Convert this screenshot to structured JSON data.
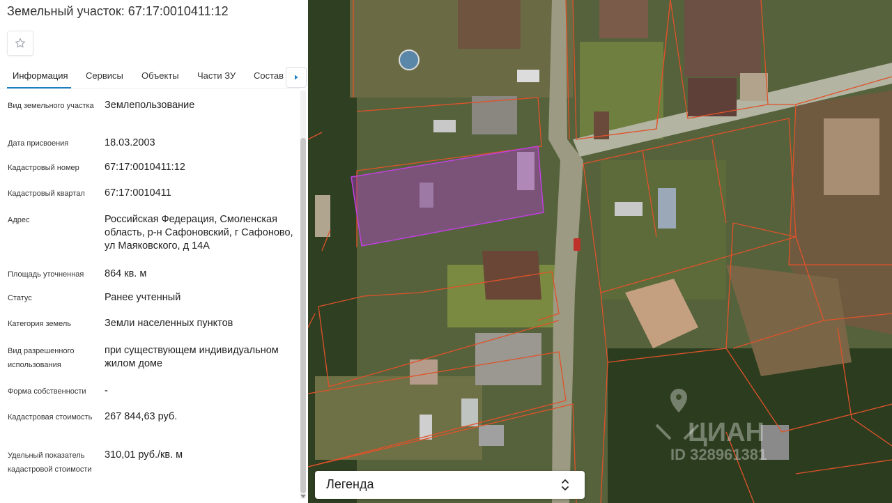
{
  "panel": {
    "title": "Земельный участок: 67:17:0010411:12",
    "favorite_icon": "star-icon",
    "tabs": [
      {
        "label": "Информация",
        "active": true
      },
      {
        "label": "Сервисы",
        "active": false
      },
      {
        "label": "Объекты",
        "active": false
      },
      {
        "label": "Части ЗУ",
        "active": false
      },
      {
        "label": "Состав",
        "active": false
      }
    ],
    "tabs_next_icon": "chevron-right-icon",
    "accent_color": "#1a7fc1",
    "info": [
      {
        "label": "Вид земельного участка",
        "value": "Землепользование"
      },
      {
        "label": "Дата присвоения",
        "value": "18.03.2003"
      },
      {
        "label": "Кадастровый номер",
        "value": "67:17:0010411:12"
      },
      {
        "label": "Кадастровый квартал",
        "value": "67:17:0010411"
      },
      {
        "label": "Адрес",
        "value": "Российская Федерация, Смоленская область, р-н Сафоновский, г Сафоново, ул Маяковского, д 14А"
      },
      {
        "label": "Площадь уточненная",
        "value": "864 кв. м"
      },
      {
        "label": "Статус",
        "value": "Ранее учтенный"
      },
      {
        "label": "Категория земель",
        "value": "Земли населенных пунктов"
      },
      {
        "label": "Вид разрешенного использования",
        "value": "при существующем индивидуальном жилом доме"
      },
      {
        "label": "Форма собственности",
        "value": "-"
      },
      {
        "label": "Кадастровая стоимость",
        "value": "267 844,63 руб."
      },
      {
        "label": "Удельный показатель кадастровой стоимости",
        "value": "310,01 руб./кв. м"
      }
    ]
  },
  "map": {
    "legend_label": "Легенда",
    "legend_icon": "chevron-updown-icon",
    "parcel_highlight_color": "#b43cd2",
    "boundary_color": "#e0522a",
    "watermark": {
      "logo": "ЦИАН",
      "id": "ID 328961381"
    }
  }
}
